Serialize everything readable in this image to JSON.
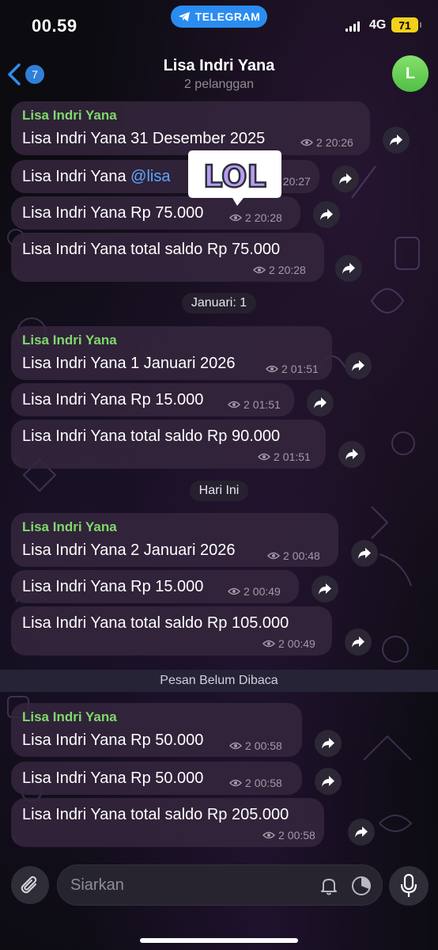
{
  "status_bar": {
    "time": "00.59",
    "app_pill": "TELEGRAM",
    "network": "4G",
    "battery": "71"
  },
  "header": {
    "back_count": "7",
    "title": "Lisa Indri Yana",
    "subtitle": "2 pelanggan",
    "avatar_letter": "L"
  },
  "messages": [
    {
      "sender": "Lisa Indri Yana",
      "text": "Lisa Indri Yana 31 Desember 2025",
      "views": "2",
      "time": "20:26"
    },
    {
      "text_a": "Lisa Indri Yana ",
      "mention": "@lisa",
      "views": "2",
      "time": "20:27"
    },
    {
      "text": "Lisa Indri Yana Rp 75.000",
      "views": "2",
      "time": "20:28"
    },
    {
      "text": "Lisa Indri Yana total saldo Rp 75.000",
      "views": "2",
      "time": "20:28"
    },
    {
      "sender": "Lisa Indri Yana",
      "text": "Lisa Indri Yana 1 Januari 2026",
      "views": "2",
      "time": "01:51"
    },
    {
      "text": "Lisa Indri Yana Rp 15.000",
      "views": "2",
      "time": "01:51"
    },
    {
      "text": "Lisa Indri Yana total saldo Rp 90.000",
      "views": "2",
      "time": "01:51"
    },
    {
      "sender": "Lisa Indri Yana",
      "text": "Lisa Indri Yana 2 Januari 2026",
      "views": "2",
      "time": "00:48"
    },
    {
      "text": "Lisa Indri Yana Rp 15.000",
      "views": "2",
      "time": "00:49"
    },
    {
      "text": "Lisa Indri Yana total saldo Rp 105.000",
      "views": "2",
      "time": "00:49"
    },
    {
      "sender": "Lisa Indri Yana",
      "text": "Lisa Indri Yana Rp 50.000",
      "views": "2",
      "time": "00:58"
    },
    {
      "text": "Lisa Indri Yana Rp 50.000",
      "views": "2",
      "time": "00:58"
    },
    {
      "text": "Lisa Indri Yana total saldo Rp 205.000",
      "views": "2",
      "time": "00:58"
    }
  ],
  "separators": {
    "januari": "Januari: 1",
    "hari_ini": "Hari Ini",
    "unread": "Pesan Belum Dibaca"
  },
  "sticker": {
    "text": "LOL"
  },
  "input": {
    "placeholder": "Siarkan"
  },
  "colors": {
    "sender": "#7fd96a",
    "mention": "#5aa8ff",
    "accent": "#2a8cf0",
    "avatar": "#5fcf50"
  }
}
